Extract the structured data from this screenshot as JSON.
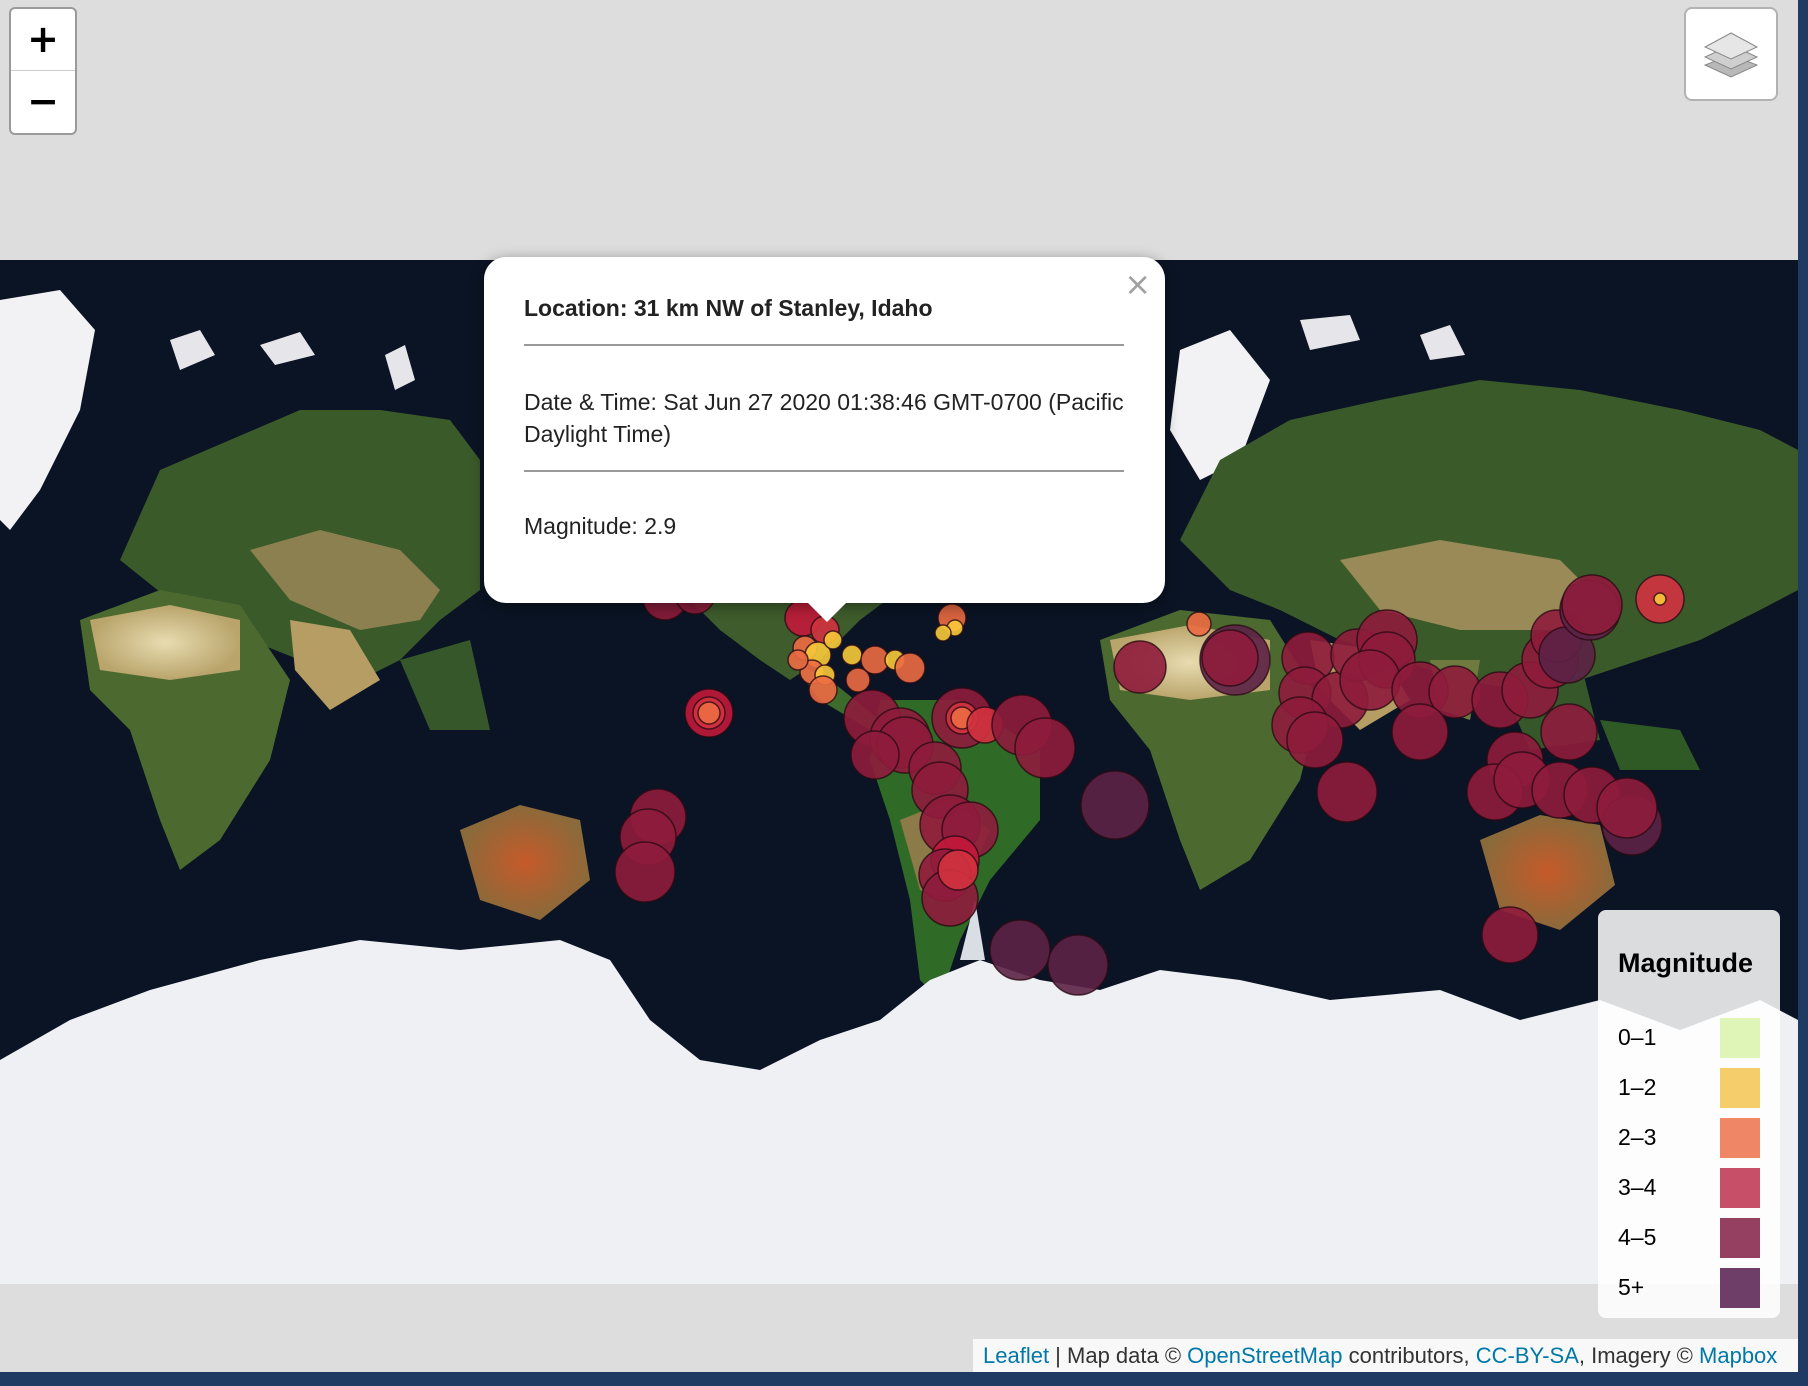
{
  "map": {
    "zoom_in_label": "+",
    "zoom_out_label": "−",
    "layers_icon": "layers-icon",
    "popup": {
      "close_label": "×",
      "location": "Location: 31 km NW of Stanley, Idaho",
      "datetime": "Date & Time: Sat Jun 27 2020 01:38:46 GMT-0700 (Pacific Daylight Time)",
      "magnitude": "Magnitude: 2.9"
    },
    "legend": {
      "title": "Magnitude",
      "items": [
        {
          "label": "0–1",
          "color": "#dff5b8"
        },
        {
          "label": "1–2",
          "color": "#f5cd6a"
        },
        {
          "label": "2–3",
          "color": "#ef8666"
        },
        {
          "label": "3–4",
          "color": "#c75068"
        },
        {
          "label": "4–5",
          "color": "#954060"
        },
        {
          "label": "5+",
          "color": "#6f3e68"
        }
      ]
    },
    "attribution": {
      "leaflet": "Leaflet",
      "sep1": " | Map data © ",
      "osm": "OpenStreetMap",
      "sep2": " contributors, ",
      "license": "CC-BY-SA",
      "sep3": ", Imagery © ",
      "mapbox": "Mapbox"
    },
    "colors": {
      "m1_2": "#f8c93a",
      "m2_3": "#ec6b42",
      "m3_4": "#d3323f",
      "m4_5": "#8e1c3c",
      "m5plus": "#5c2246"
    }
  }
}
